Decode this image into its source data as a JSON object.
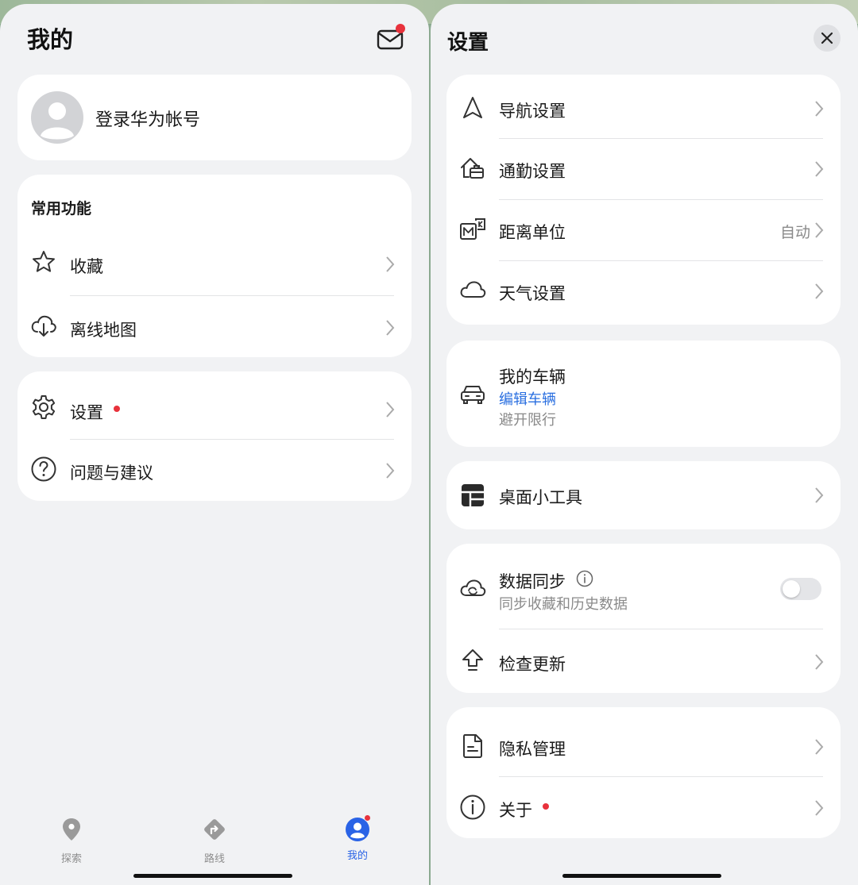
{
  "colors": {
    "accent": "#2a63e6",
    "badge": "#e8323c",
    "link": "#2a6fe0"
  },
  "left": {
    "title": "我的",
    "mail_icon": "mail-icon",
    "account": {
      "label": "登录华为帐号",
      "avatar_icon": "avatar-icon"
    },
    "common": {
      "heading": "常用功能",
      "items": [
        {
          "label": "收藏",
          "icon": "star-icon"
        },
        {
          "label": "离线地图",
          "icon": "cloud-download-icon"
        }
      ]
    },
    "misc": {
      "items": [
        {
          "label": "设置",
          "icon": "gear-icon",
          "badge": true
        },
        {
          "label": "问题与建议",
          "icon": "help-circle-icon"
        }
      ]
    },
    "tabs": [
      {
        "label": "探索",
        "icon": "location-pin-icon"
      },
      {
        "label": "路线",
        "icon": "route-icon"
      },
      {
        "label": "我的",
        "icon": "profile-icon",
        "active": true,
        "badge": true
      }
    ]
  },
  "right": {
    "title": "设置",
    "close_icon": "close-icon",
    "group1": [
      {
        "label": "导航设置",
        "icon": "navigation-arrow-icon"
      },
      {
        "label": "通勤设置",
        "icon": "commute-icon"
      },
      {
        "label": "距离单位",
        "icon": "distance-unit-icon",
        "value": "自动"
      },
      {
        "label": "天气设置",
        "icon": "weather-cloud-icon"
      }
    ],
    "vehicle": {
      "label": "我的车辆",
      "icon": "car-icon",
      "link": "编辑车辆",
      "sub": "避开限行"
    },
    "widget": {
      "label": "桌面小工具",
      "icon": "widget-icon"
    },
    "sync": {
      "label": "数据同步",
      "icon": "cloud-sync-icon",
      "info_icon": "info-icon",
      "sub": "同步收藏和历史数据",
      "toggle_on": false
    },
    "update": {
      "label": "检查更新",
      "icon": "upload-arrow-icon"
    },
    "group5": [
      {
        "label": "隐私管理",
        "icon": "document-icon"
      },
      {
        "label": "关于",
        "icon": "info-circle-icon",
        "badge": true
      }
    ]
  }
}
